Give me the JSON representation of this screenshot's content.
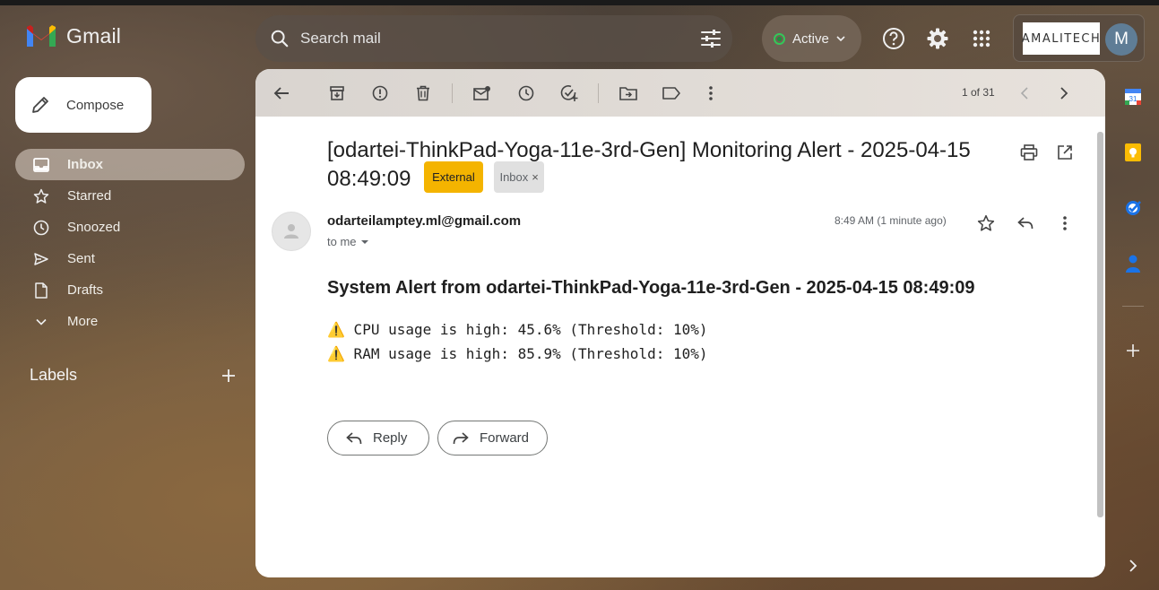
{
  "app": {
    "name": "Gmail"
  },
  "search": {
    "placeholder": "Search mail"
  },
  "status": {
    "label": "Active",
    "color": "#1e8e3e"
  },
  "account": {
    "org_logo_text": "AMALITECH",
    "avatar_letter": "M"
  },
  "sidebar": {
    "compose_label": "Compose",
    "items": [
      {
        "label": "Inbox",
        "icon": "inbox-icon",
        "active": true
      },
      {
        "label": "Starred",
        "icon": "star-icon"
      },
      {
        "label": "Snoozed",
        "icon": "clock-icon"
      },
      {
        "label": "Sent",
        "icon": "send-icon"
      },
      {
        "label": "Drafts",
        "icon": "draft-icon"
      },
      {
        "label": "More",
        "icon": "chevron-down-icon"
      }
    ],
    "labels_heading": "Labels"
  },
  "toolbar": {
    "pager": "1 of 31"
  },
  "email": {
    "subject": "[odartei-ThinkPad-Yoga-11e-3rd-Gen] Monitoring Alert - 2025-04-15 08:49:09",
    "badge_external": "External",
    "badge_inbox": "Inbox",
    "from": "odarteilamptey.ml@gmail.com",
    "to": "to me",
    "time": "8:49 AM (1 minute ago)",
    "body_title": "System Alert from odartei-ThinkPad-Yoga-11e-3rd-Gen - 2025-04-15 08:49:09",
    "lines": [
      "⚠️ CPU usage is high: 45.6% (Threshold: 10%)",
      "⚠️ RAM usage is high: 85.9% (Threshold: 10%)"
    ],
    "reply_label": "Reply",
    "forward_label": "Forward"
  },
  "colors": {
    "external_badge": "#f4b400",
    "inbox_badge": "#e0e0e0",
    "brand_red": "#ea4335"
  }
}
